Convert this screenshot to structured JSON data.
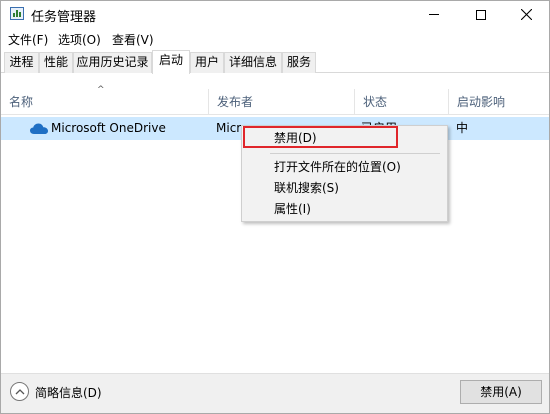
{
  "window": {
    "title": "任务管理器"
  },
  "menu": [
    "文件(F)",
    "选项(O)",
    "查看(V)"
  ],
  "tabs": [
    "进程",
    "性能",
    "应用历史记录",
    "启动",
    "用户",
    "详细信息",
    "服务"
  ],
  "active_tab": "启动",
  "table": {
    "headers": [
      "名称",
      "发布者",
      "状态",
      "启动影响"
    ],
    "rows": [
      {
        "name": "Microsoft OneDrive",
        "publisher": "Micros",
        "status": "已启用",
        "impact": "中"
      }
    ]
  },
  "context_menu": {
    "items": [
      "禁用(D)",
      "打开文件所在的位置(O)",
      "联机搜索(S)",
      "属性(I)"
    ]
  },
  "footer": {
    "less_details": "简略信息(D)",
    "disable_button": "禁用(A)"
  },
  "icons": {
    "app": "task-manager-icon",
    "row": "onedrive-cloud-icon",
    "collapse": "chevron-up-circle-icon"
  },
  "colors": {
    "row_selected": "#cce8ff",
    "highlight": "#e0262b",
    "header_text": "#4c607a"
  }
}
